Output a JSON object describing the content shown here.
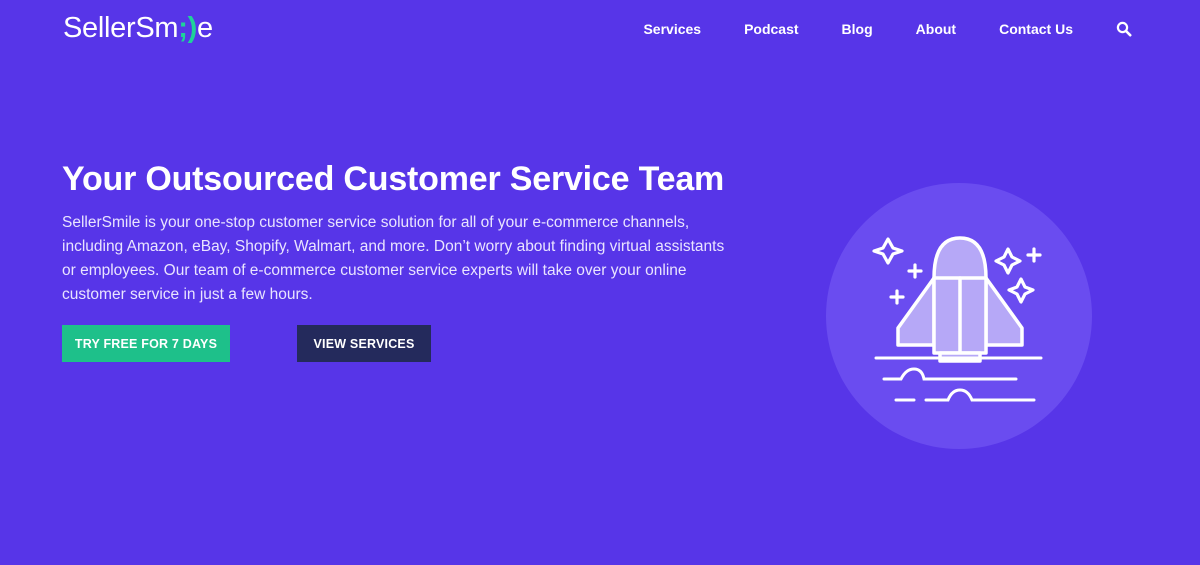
{
  "logo": {
    "text_main": "SellerSm",
    "text_smile": ";)",
    "text_end": "e"
  },
  "nav": {
    "items": [
      "Services",
      "Podcast",
      "Blog",
      "About",
      "Contact Us"
    ]
  },
  "hero": {
    "title": "Your Outsourced Customer Service Team",
    "description": "SellerSmile is your one-stop customer service solution for all of your e-commerce channels, including Amazon, eBay, Shopify, Walmart, and more. Don’t worry about finding virtual assistants or employees. Our team of e-commerce customer service experts will take over your online customer service in just a few hours.",
    "primary_button": "TRY FREE FOR 7 DAYS",
    "secondary_button": "VIEW SERVICES"
  },
  "colors": {
    "background": "#5735e8",
    "accent_green": "#1ec08a",
    "dark_button": "#242a5c",
    "art_circle": "#6a4cf0"
  },
  "icons": {
    "search": "search-icon",
    "illustration": "rocket-icon"
  }
}
